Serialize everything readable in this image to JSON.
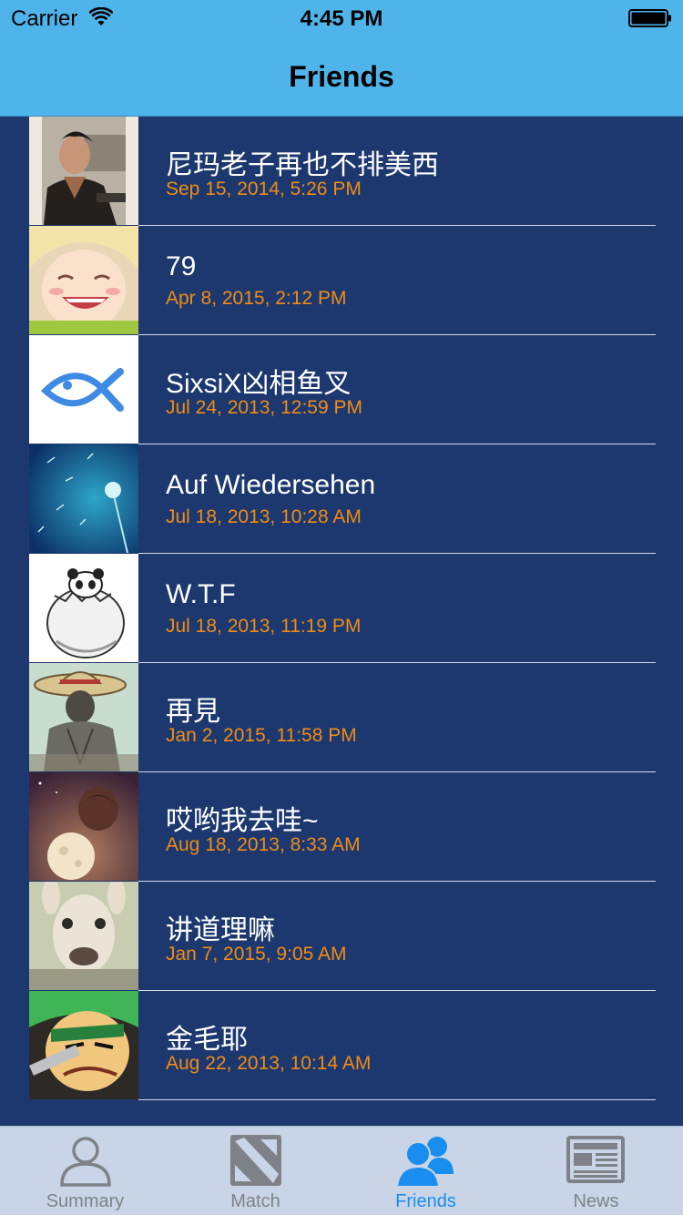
{
  "status_bar": {
    "carrier": "Carrier",
    "time": "4:45 PM"
  },
  "nav": {
    "title": "Friends"
  },
  "friends": [
    {
      "name": "尼玛老子再也不排美西",
      "date": "Sep 15, 2014, 5:26 PM",
      "avatar": "man-in-car-photo"
    },
    {
      "name": "79",
      "date": "Apr 8, 2015, 2:12 PM",
      "avatar": "smiling-anime-boy"
    },
    {
      "name": "SixsiX凶相鱼叉",
      "date": "Jul 24, 2013, 12:59 PM",
      "avatar": "blue-fish-logo"
    },
    {
      "name": "Auf Wiedersehen",
      "date": "Jul 18, 2013, 10:28 AM",
      "avatar": "dandelion-blue"
    },
    {
      "name": "W.T.F",
      "date": "Jul 18, 2013, 11:19 PM",
      "avatar": "panda-in-egg"
    },
    {
      "name": "再見",
      "date": "Jan 2, 2015, 11:58 PM",
      "avatar": "straw-hat-pirate"
    },
    {
      "name": "哎哟我去哇~",
      "date": "Aug 18, 2013, 8:33 AM",
      "avatar": "person-with-moon"
    },
    {
      "name": "讲道理嘛",
      "date": "Jan 7, 2015, 9:05 AM",
      "avatar": "alpaca"
    },
    {
      "name": "金毛耶",
      "date": "Aug 22, 2013, 10:14 AM",
      "avatar": "green-haired-swordsman"
    },
    {
      "name": "",
      "date": "",
      "avatar": "blond-anime-character"
    }
  ],
  "tabs": [
    {
      "label": "Summary",
      "icon": "person-icon",
      "active": false
    },
    {
      "label": "Match",
      "icon": "dota-icon",
      "active": false
    },
    {
      "label": "Friends",
      "icon": "friends-icon",
      "active": true
    },
    {
      "label": "News",
      "icon": "newspaper-icon",
      "active": false
    }
  ],
  "colors": {
    "bar": "#4fb4ea",
    "background": "#1c386f",
    "date": "#f08c14",
    "tab_active": "#1a8ef0",
    "tab_inactive": "#7e8288"
  }
}
